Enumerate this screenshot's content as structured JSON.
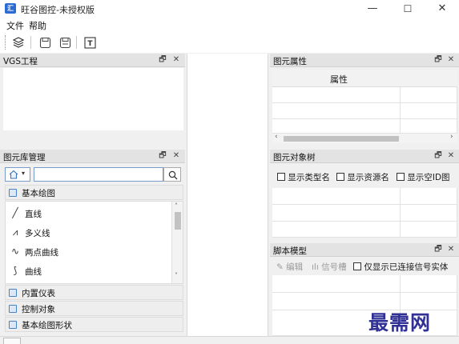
{
  "app": {
    "icon_label": "汇",
    "title": "旺谷图控-未授权版"
  },
  "window_controls": {
    "minimize": "—",
    "maximize": "☐",
    "close": "✕"
  },
  "menu": [
    {
      "label": "文件"
    },
    {
      "label": "帮助"
    }
  ],
  "toolbar": {
    "icons": [
      "layers-icon",
      "save-icon",
      "save-as-icon",
      "text-tool-icon"
    ],
    "text_tool_glyph": "T"
  },
  "panels": {
    "vgs_project": {
      "title": "VGS工程"
    },
    "element_library": {
      "title": "图元库管理",
      "search_value": "",
      "categories": [
        {
          "label": "基本绘图"
        },
        {
          "label": "内置仪表"
        },
        {
          "label": "控制对象"
        },
        {
          "label": "基本绘图形状"
        }
      ],
      "items": [
        {
          "icon_glyph": "╱",
          "label": "直线"
        },
        {
          "icon_glyph": "⩘",
          "label": "多义线"
        },
        {
          "icon_glyph": "∿",
          "label": "两点曲线"
        },
        {
          "icon_glyph": "⟆",
          "label": "曲线"
        }
      ]
    },
    "element_properties": {
      "title": "图元属性",
      "column_header": "属性"
    },
    "element_tree": {
      "title": "图元对象树",
      "options": [
        "显示类型名",
        "显示资源名",
        "显示空ID图"
      ]
    },
    "script_model": {
      "title": "脚本模型",
      "edit_label": "编辑",
      "signal_label": "信号槽",
      "option_label": "仅显示已连接信号实体"
    }
  },
  "pane_buttons": {
    "float": "🗗",
    "close": "✕"
  },
  "watermark": "最需网",
  "colors": {
    "accent": "#2b6cd4",
    "watermark": "#303096",
    "header_bg": "#e3e3e3"
  }
}
